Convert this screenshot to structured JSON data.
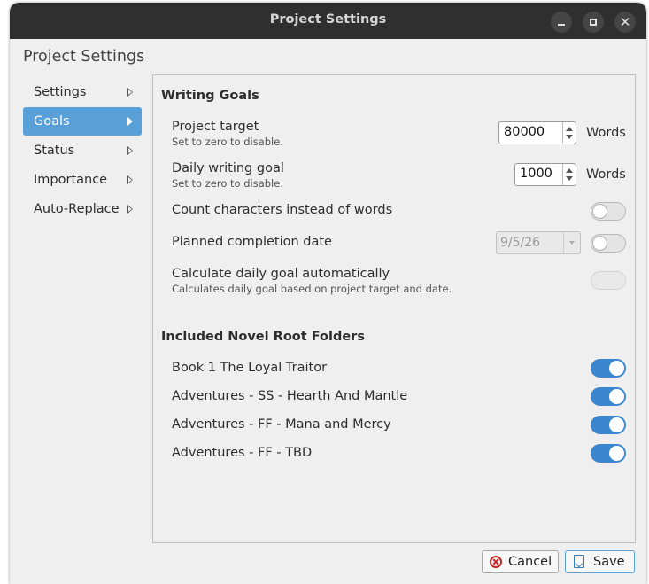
{
  "window": {
    "title": "Project Settings"
  },
  "dialog": {
    "heading": "Project Settings"
  },
  "sidebar": {
    "items": [
      {
        "label": "Settings",
        "active": false
      },
      {
        "label": "Goals",
        "active": true
      },
      {
        "label": "Status",
        "active": false
      },
      {
        "label": "Importance",
        "active": false
      },
      {
        "label": "Auto-Replace",
        "active": false
      }
    ]
  },
  "writing_goals": {
    "title": "Writing Goals",
    "project_target": {
      "label": "Project target",
      "sub": "Set to zero to disable.",
      "value": "80000",
      "unit": "Words"
    },
    "daily_goal": {
      "label": "Daily writing goal",
      "sub": "Set to zero to disable.",
      "value": "1000",
      "unit": "Words"
    },
    "count_characters": {
      "label": "Count characters instead of words",
      "enabled": false
    },
    "planned_completion": {
      "label": "Planned completion date",
      "date": "9/5/26",
      "enabled": false
    },
    "calc_daily": {
      "label": "Calculate daily goal automatically",
      "sub": "Calculates daily goal based on project target and date.",
      "enabled": false,
      "disabled": true
    }
  },
  "root_folders": {
    "title": "Included Novel Root Folders",
    "items": [
      {
        "label": "Book 1 The Loyal Traitor",
        "enabled": true
      },
      {
        "label": "Adventures - SS - Hearth And Mantle",
        "enabled": true
      },
      {
        "label": "Adventures - FF - Mana and Mercy",
        "enabled": true
      },
      {
        "label": "Adventures - FF - TBD",
        "enabled": true
      }
    ]
  },
  "buttons": {
    "cancel": "Cancel",
    "save": "Save"
  },
  "colors": {
    "accent": "#3a87cf",
    "sidebar_active": "#5aa0d8",
    "titlebar": "#2f2f2f",
    "cancel_icon": "#c62828"
  },
  "icons": {
    "cancel": "cancel-circle-icon",
    "save": "save-file-icon"
  }
}
